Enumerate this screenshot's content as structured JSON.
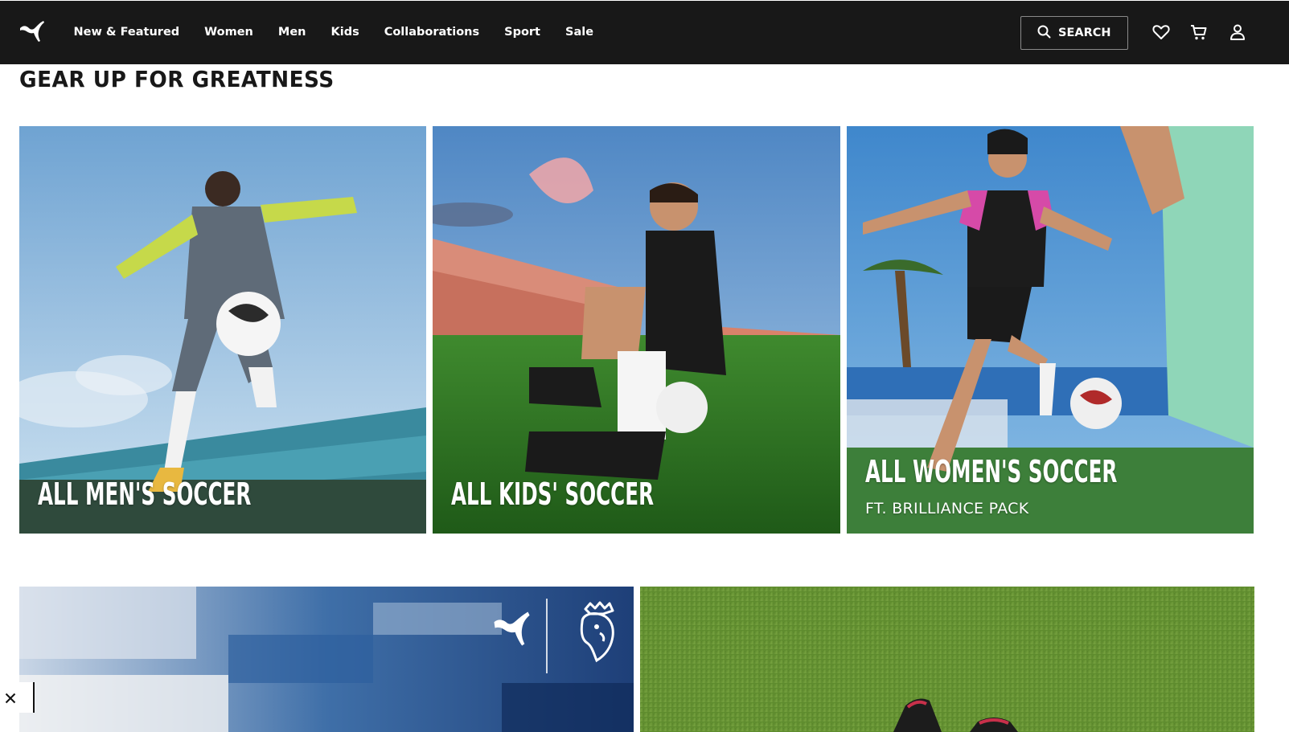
{
  "header": {
    "nav": [
      "New & Featured",
      "Women",
      "Men",
      "Kids",
      "Collaborations",
      "Sport",
      "Sale"
    ],
    "search_label": "SEARCH"
  },
  "main": {
    "title": "GEAR UP FOR GREATNESS",
    "tiles": [
      {
        "label": "ALL MEN'S SOCCER"
      },
      {
        "label": "ALL KIDS' SOCCER"
      },
      {
        "label": "ALL WOMEN'S SOCCER",
        "sub": "FT. BRILLIANCE PACK"
      }
    ]
  },
  "colors": {
    "header_bg": "#181818",
    "text": "#181818",
    "white": "#ffffff"
  },
  "icons": [
    "puma-logo-icon",
    "search-icon",
    "heart-icon",
    "cart-icon",
    "user-icon",
    "close-icon",
    "premier-league-icon"
  ]
}
